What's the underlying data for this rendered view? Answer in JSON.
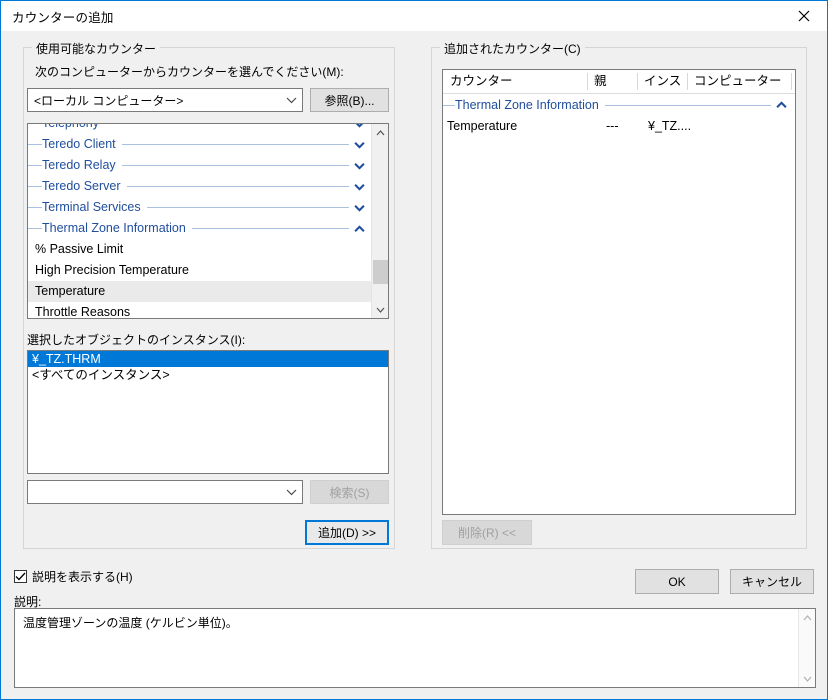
{
  "window": {
    "title": "カウンターの追加",
    "close_label": "×"
  },
  "available": {
    "group_label": "使用可能なカウンター",
    "computer_prompt": "次のコンピューターからカウンターを選んでください(M):",
    "computer_value": "<ローカル コンピューター>",
    "browse_button": "参照(B)...",
    "tree": [
      {
        "type": "category",
        "label": "Telephony",
        "expanded": false,
        "clipped": true
      },
      {
        "type": "category",
        "label": "Teredo Client",
        "expanded": false
      },
      {
        "type": "category",
        "label": "Teredo Relay",
        "expanded": false
      },
      {
        "type": "category",
        "label": "Teredo Server",
        "expanded": false
      },
      {
        "type": "category",
        "label": "Terminal Services",
        "expanded": false
      },
      {
        "type": "category",
        "label": "Thermal Zone Information",
        "expanded": true
      },
      {
        "type": "counter",
        "label": "% Passive Limit",
        "selected": false
      },
      {
        "type": "counter",
        "label": "High Precision Temperature",
        "selected": false
      },
      {
        "type": "counter",
        "label": "Temperature",
        "selected": true
      },
      {
        "type": "counter",
        "label": "Throttle Reasons",
        "selected": false,
        "clipped": true
      }
    ],
    "instances_label": "選択したオブジェクトのインスタンス(I):",
    "instances": [
      {
        "label": "¥_TZ.THRM",
        "selected": true
      },
      {
        "label": "<すべてのインスタンス>",
        "selected": false
      }
    ],
    "search_value": "",
    "search_button": "検索(S)",
    "add_button": "追加(D) >>"
  },
  "added": {
    "group_label": "追加されたカウンター(C)",
    "columns": [
      "カウンター",
      "親",
      "インス",
      "コンピューター"
    ],
    "rows": [
      {
        "type": "category",
        "counter": "Thermal Zone Information",
        "expanded": true
      },
      {
        "type": "counter",
        "counter": "Temperature",
        "parent": "---",
        "instance": "¥_TZ....",
        "computer": ""
      }
    ],
    "remove_button": "削除(R) <<"
  },
  "footer": {
    "show_description_label": "説明を表示する(H)",
    "show_description_checked": true,
    "description_label": "説明:",
    "description_text": "温度管理ゾーンの温度 (ケルビン単位)。",
    "ok_button": "OK",
    "cancel_button": "キャンセル"
  },
  "colors": {
    "accent": "#0078d7",
    "category_text": "#1f4e9c",
    "selection": "#0078d7",
    "row_highlight": "#eaeaea"
  }
}
